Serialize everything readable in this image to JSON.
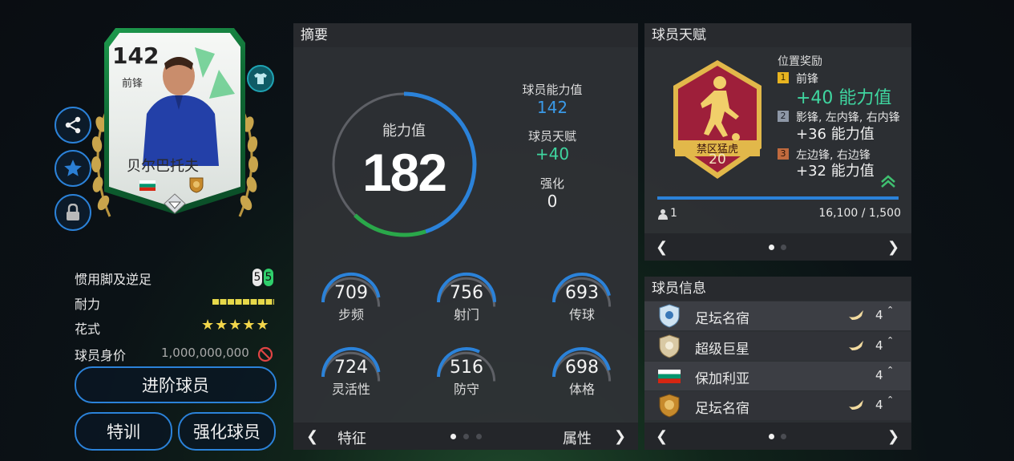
{
  "card": {
    "rating": "142",
    "position": "前锋",
    "name": "贝尔巴托夫"
  },
  "left_stats": {
    "weak_foot_label": "惯用脚及逆足",
    "weak_foot_left": "5",
    "weak_foot_right": "5",
    "stamina_label": "耐力",
    "skills_label": "花式",
    "skill_stars": "★★★★★",
    "value_label": "球员身价",
    "value": "1,000,000,000"
  },
  "buttons": {
    "advance": "进阶球员",
    "training": "特训",
    "enhance": "强化球员"
  },
  "summary": {
    "title": "摘要",
    "ovr_label": "能力值",
    "ovr": "182",
    "player_ovr_label": "球员能力值",
    "player_ovr": "142",
    "talent_label": "球员天赋",
    "talent": "+40",
    "enhance_label": "强化",
    "enhance": "0",
    "ovr_fraction": 0.5,
    "attributes": [
      {
        "value": "709",
        "label": "步频",
        "fill": 0.9
      },
      {
        "value": "756",
        "label": "射门",
        "fill": 0.95
      },
      {
        "value": "693",
        "label": "传球",
        "fill": 0.88
      },
      {
        "value": "724",
        "label": "灵活性",
        "fill": 0.9
      },
      {
        "value": "516",
        "label": "防守",
        "fill": 0.62
      },
      {
        "value": "698",
        "label": "体格",
        "fill": 0.88
      }
    ],
    "pager_left": "特征",
    "pager_right": "属性"
  },
  "talent_panel": {
    "title": "球员天赋",
    "badge_name": "禁区猛虎",
    "badge_level": "20",
    "bonus_title": "位置奖励",
    "bonuses": [
      {
        "rank": "1",
        "positions": "前锋",
        "bonus": "+40 能力值"
      },
      {
        "rank": "2",
        "positions": "影锋, 左内锋, 右内锋",
        "bonus": "+36 能力值"
      },
      {
        "rank": "3",
        "positions": "左边锋, 右边锋",
        "bonus": "+32 能力值"
      }
    ],
    "count": "1",
    "progress": "16,100 / 1,500"
  },
  "info_panel": {
    "title": "球员信息",
    "rows": [
      {
        "name": "足坛名宿",
        "level": "4"
      },
      {
        "name": "超级巨星",
        "level": "4"
      },
      {
        "name": "保加利亚",
        "level": "4"
      },
      {
        "name": "足坛名宿",
        "level": "4"
      }
    ]
  },
  "colors": {
    "accent_blue": "#2b82d9",
    "talent_green": "#3fd6a0",
    "badge_red": "#9e1f3a",
    "badge_gold": "#e2b84a"
  }
}
